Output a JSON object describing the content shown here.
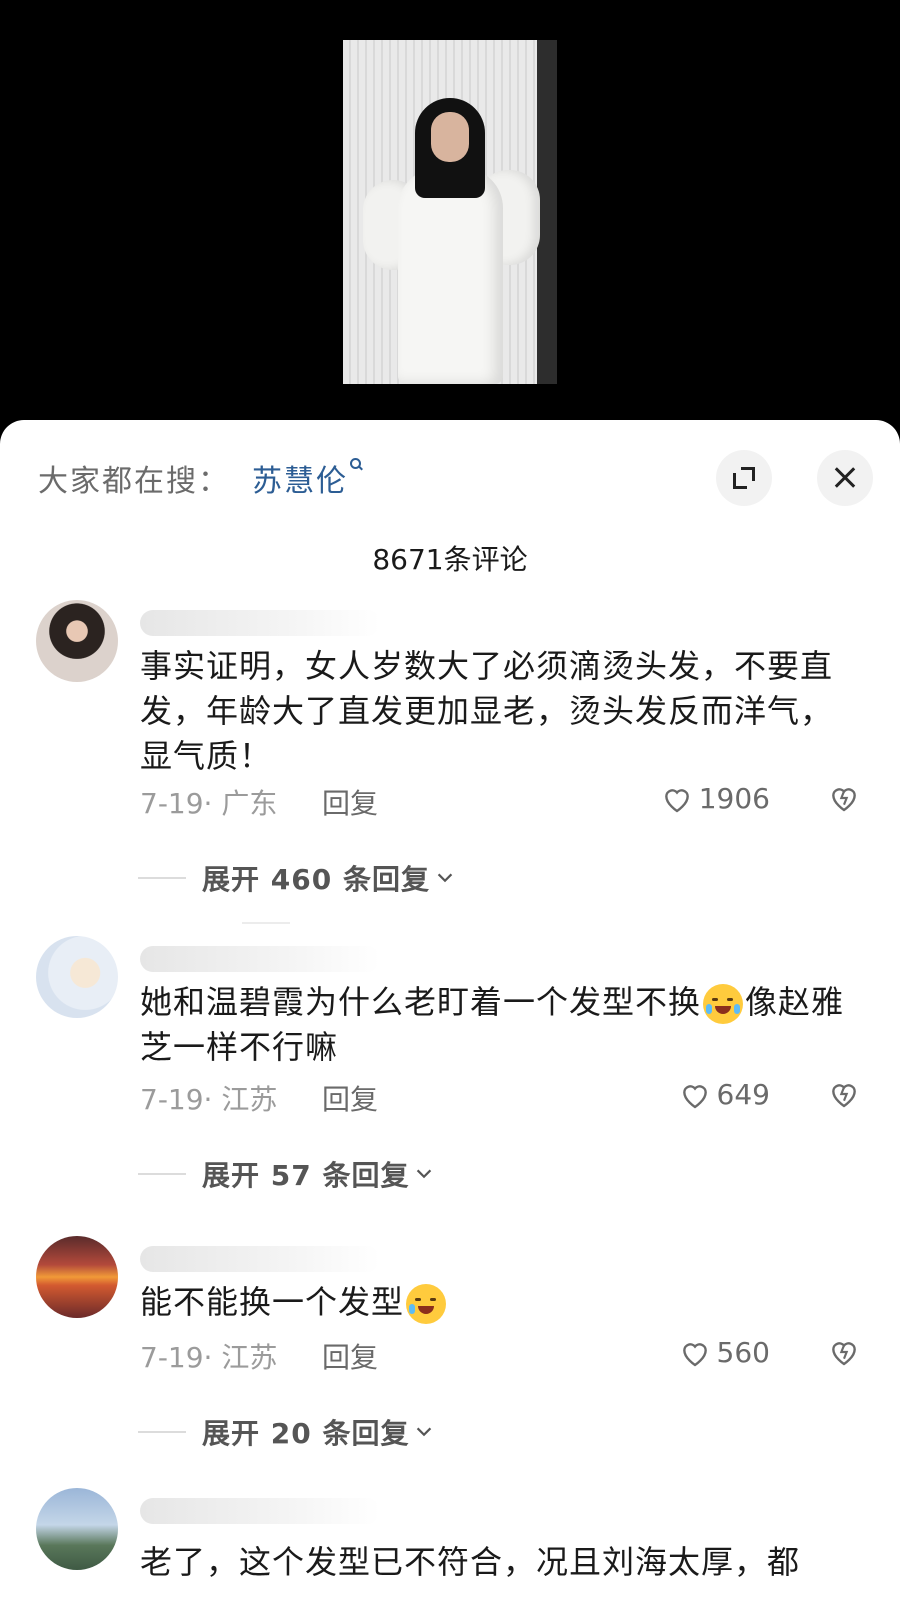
{
  "search": {
    "prefix": "大家都在搜：",
    "term": "苏慧伦"
  },
  "comments_count": "8671条评论",
  "comments": [
    {
      "text": "事实证明，女人岁数大了必须滴烫头发，不要直发，年龄大了直发更加显老，烫头发反而洋气，显气质！",
      "meta": "7-19· 广东",
      "reply": "回复",
      "likes": "1906",
      "expand": "展开 460 条回复"
    },
    {
      "text": "她和温碧霞为什么老盯着一个发型不换",
      "text_after_emoji": "像赵雅芝一样不行嘛",
      "emoji": "rofl-emoji",
      "meta": "7-19· 江苏",
      "reply": "回复",
      "likes": "649",
      "expand": "展开 57 条回复"
    },
    {
      "text": "能不能换一个发型",
      "emoji": "crying-emoji",
      "meta": "7-19· 江苏",
      "reply": "回复",
      "likes": "560",
      "expand": "展开 20 条回复"
    },
    {
      "text": "老了，这个发型已不符合，况且刘海太厚，都"
    }
  ],
  "colors": {
    "search_term": "#2c5d94",
    "meta": "#9b9b9b"
  }
}
